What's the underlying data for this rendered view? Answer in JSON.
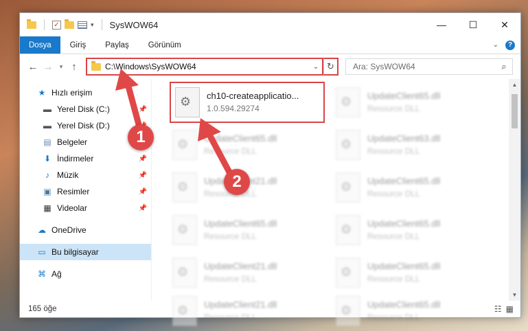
{
  "window": {
    "title": "SysWOW64"
  },
  "ribbon": {
    "tabs": [
      "Dosya",
      "Giriş",
      "Paylaş",
      "Görünüm"
    ],
    "help": "?"
  },
  "nav": {
    "address": "C:\\Windows\\SysWOW64",
    "search_placeholder": "Ara: SysWOW64"
  },
  "sidebar": {
    "quick_access": "Hızlı erişim",
    "items": [
      "Yerel Disk (C:)",
      "Yerel Disk (D:)",
      "Belgeler",
      "İndirmeler",
      "Müzik",
      "Resimler",
      "Videolar"
    ],
    "onedrive": "OneDrive",
    "this_pc": "Bu bilgisayar",
    "network": "Ağ"
  },
  "files": {
    "highlighted": {
      "name": "ch10-createapplicatio...",
      "version": "1.0.594.29274"
    },
    "col1": [
      {
        "name": "UpdateClient65.dll",
        "type": "Resource DLL"
      },
      {
        "name": "UpdateClient21.dll",
        "type": "Resource DLL"
      },
      {
        "name": "UpdateClient65.dll",
        "type": "Resource DLL"
      },
      {
        "name": "UpdateClient21.dll",
        "type": "Resource DLL"
      },
      {
        "name": "UpdateClient21.dll",
        "type": "Resource DLL"
      }
    ],
    "col2": [
      {
        "name": "UpdateClient65.dll",
        "type": "Resource DLL"
      },
      {
        "name": "UpdateClient63.dll",
        "type": "Resource DLL"
      },
      {
        "name": "UpdateClient65.dll",
        "type": "Resource DLL"
      },
      {
        "name": "UpdateClient65.dll",
        "type": "Resource DLL"
      },
      {
        "name": "UpdateClient65.dll",
        "type": "Resource DLL"
      },
      {
        "name": "UpdateClient65.dll",
        "type": "Resource DLL"
      }
    ]
  },
  "status": {
    "count": "165 öğe"
  },
  "annotations": {
    "step1": "1",
    "step2": "2"
  },
  "colors": {
    "accent": "#1979ca",
    "annotation": "#e04848"
  }
}
